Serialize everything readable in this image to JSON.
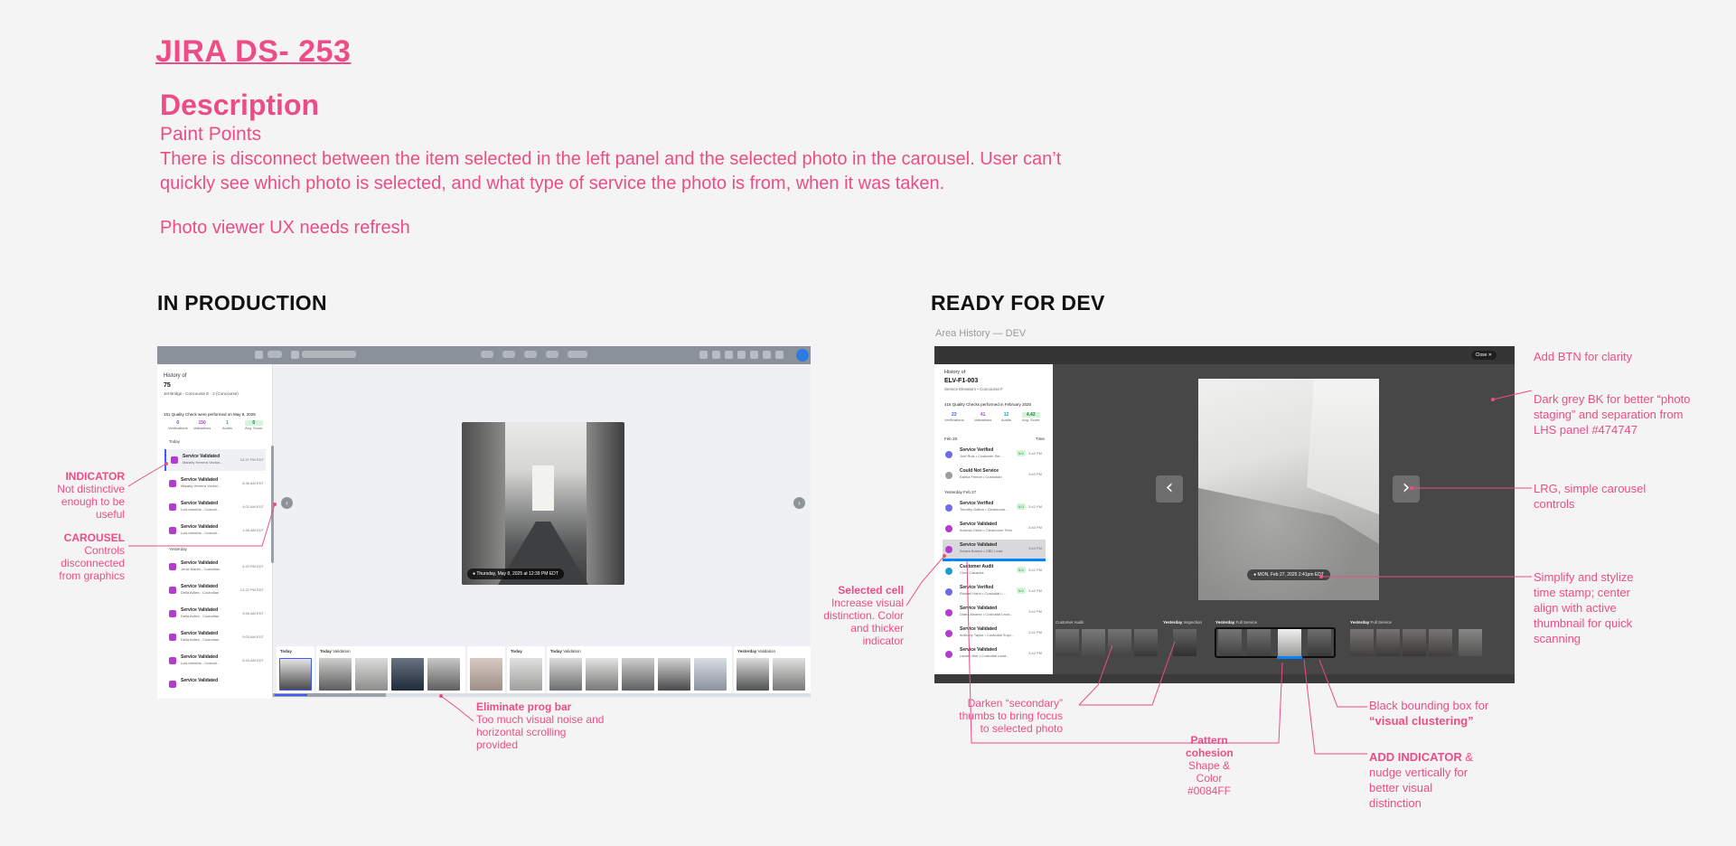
{
  "header": {
    "jira": "JIRA  DS- 253",
    "description_title": "Description",
    "paint_points": "Paint Points",
    "body": "There is disconnect between the item selected in the left panel and the selected photo in the carousel. User can’t quickly see which photo is selected, and what type of service the photo is from, when it was taken.",
    "note": "Photo viewer UX needs refresh"
  },
  "production": {
    "heading": "IN PRODUCTION",
    "left_panel": {
      "history_of": "History of",
      "count": "75",
      "location": "Jet Bridge - Concourse E - 2 (Concourse)",
      "checks": "151 Quality Check were performed on May 8, 2025",
      "stats": [
        {
          "n": "0",
          "l": "Verifications"
        },
        {
          "n": "150",
          "l": "Validations"
        },
        {
          "n": "1",
          "l": "Audits"
        },
        {
          "n": "0",
          "l": "Avg. Score"
        }
      ],
      "today_label": "Today",
      "yesterday_label": "Yesterday",
      "rows": [
        {
          "title": "Service Validated",
          "sub": "Maraby Herrera Vectori...",
          "time": "12:37 PM EDT"
        },
        {
          "title": "Service Validated",
          "sub": "Maraby Herrera Vectori...",
          "time": "8:36 AM EDT"
        },
        {
          "title": "Service Validated",
          "sub": "Luis Almeida - Custodi...",
          "time": "4:02 AM EDT"
        },
        {
          "title": "Service Validated",
          "sub": "Luis Almeida - Custodi...",
          "time": "1:46 AM EDT"
        },
        {
          "title": "Service Validated",
          "sub": "Jenie Martin - Custodian",
          "time": "4:20 PM EDT"
        },
        {
          "title": "Service Validated",
          "sub": "Delia Aviles - Custodian",
          "time": "12:22 PM EDT"
        },
        {
          "title": "Service Validated",
          "sub": "Delia Aviles - Custodian",
          "time": "9:46 AM EDT"
        },
        {
          "title": "Service Validated",
          "sub": "Delia Aviles - Custodian",
          "time": "9:03 AM EDT"
        },
        {
          "title": "Service Validated",
          "sub": "Luis Almeida - Custodi...",
          "time": "5:40 AM EDT"
        },
        {
          "title": "Service Validated",
          "sub": "",
          "time": ""
        }
      ]
    },
    "photo_stamp": "Thursday, May 8, 2025 at 12:39 PM EDT",
    "nav_prev": "‹",
    "nav_next": "›",
    "strip_groups": [
      {
        "day": "Today",
        "type": ""
      },
      {
        "day": "Today",
        "type": "Validation"
      },
      {
        "day": "Today",
        "type": ""
      },
      {
        "day": "Today",
        "type": "Validation"
      },
      {
        "day": "Yesterday",
        "type": "Validation"
      }
    ]
  },
  "dev": {
    "heading": "READY FOR DEV",
    "caption": "Area History — DEV",
    "close": "Close ✕",
    "left_panel": {
      "history_of": "History of",
      "id": "ELV-F1-003",
      "location": "Service Elevators • Concourse F",
      "checks": "416 Quality Checks performed in February 2025",
      "stats": [
        {
          "n": "23",
          "l": "Verifications"
        },
        {
          "n": "41",
          "l": "Validations"
        },
        {
          "n": "12",
          "l": "Audits"
        },
        {
          "n": "4.42",
          "l": "Avg. Score"
        }
      ],
      "feb28": "Feb 28",
      "time_col": "Time",
      "yesterday": "Yesterday Feb 27",
      "rows": [
        {
          "title": "Service Verified",
          "sub": "Joel Ruiz • Customer Ser...",
          "score": "5.0",
          "time": "3:42 PM"
        },
        {
          "title": "Could Not Service",
          "sub": "Dahlia Fenton • Custodian",
          "score": "",
          "time": "3:40 PM"
        },
        {
          "title": "Service Verified",
          "sub": "Timothy Galton • Cleanroom...",
          "score": "5.0",
          "time": "3:42 PM"
        },
        {
          "title": "Service Validated",
          "sub": "Antonia Oliver • Cleanroom Tech",
          "score": "",
          "time": "3:40 PM"
        },
        {
          "title": "Service Validated",
          "sub": "Amara Bowen • CBD Lead",
          "score": "",
          "time": "3:40 PM"
        },
        {
          "title": "Customer Audit",
          "sub": "Chris Cabacha",
          "score": "5.0",
          "time": "3:42 PM"
        },
        {
          "title": "Service Verified",
          "sub": "Russell Hahn • Custodial L...",
          "score": "5.0",
          "time": "3:42 PM"
        },
        {
          "title": "Service Validated",
          "sub": "Diana Alvarez • Custodial Lead...",
          "score": "",
          "time": "3:42 PM"
        },
        {
          "title": "Service Validated",
          "sub": "Anthony Taylor • Custodial Supv...",
          "score": "",
          "time": "3:42 PM"
        },
        {
          "title": "Service Validated",
          "sub": "Lauren Kier • Custodial Lead...",
          "score": "",
          "time": "3:42 PM"
        }
      ]
    },
    "photo_stamp": "MON, Feb 27, 2025 2:41pm EDT",
    "nav_prev": "‹",
    "nav_next": "›",
    "strip_groups": [
      {
        "day": "",
        "type": "Customer Audit"
      },
      {
        "day": "Yesterday",
        "type": "Inspection"
      },
      {
        "day": "Yesterday",
        "type": "Full Service"
      },
      {
        "day": "Yesterday",
        "type": "Full Service"
      }
    ]
  },
  "annotations": {
    "indicator_title": "INDICATOR",
    "indicator_body": "Not distinctive enough to be useful",
    "carousel_title": "CAROUSEL",
    "carousel_body": "Controls disconnected from graphics",
    "prog_title": "Eliminate prog bar",
    "prog_body": "Too much visual noise and horizontal scrolling provided",
    "selected_title": "Selected cell",
    "selected_body": "Increase visual distinction. Color and thicker indicator",
    "darken": "Darken “secondary” thumbs to bring focus to selected photo",
    "pattern_title": "Pattern cohesion",
    "pattern_body": "Shape & Color #0084FF",
    "add_btn": "Add BTN for clarity",
    "dark_grey": "Dark grey BK for better “photo staging” and separation from LHS panel #474747",
    "lrg": "LRG, simple carousel controls",
    "simplify": "Simplify and stylize time stamp; center align with active thumbnail for quick scanning",
    "black_box_a": "Black bounding box for",
    "black_box_b": "“visual clustering”",
    "add_ind_a": "ADD INDICATOR",
    "add_ind_b": " & nudge vertically for better visual distinction"
  },
  "colors": {
    "accent": "#ec4d86",
    "blue": "#0084ff",
    "dark_bg": "#474747"
  }
}
